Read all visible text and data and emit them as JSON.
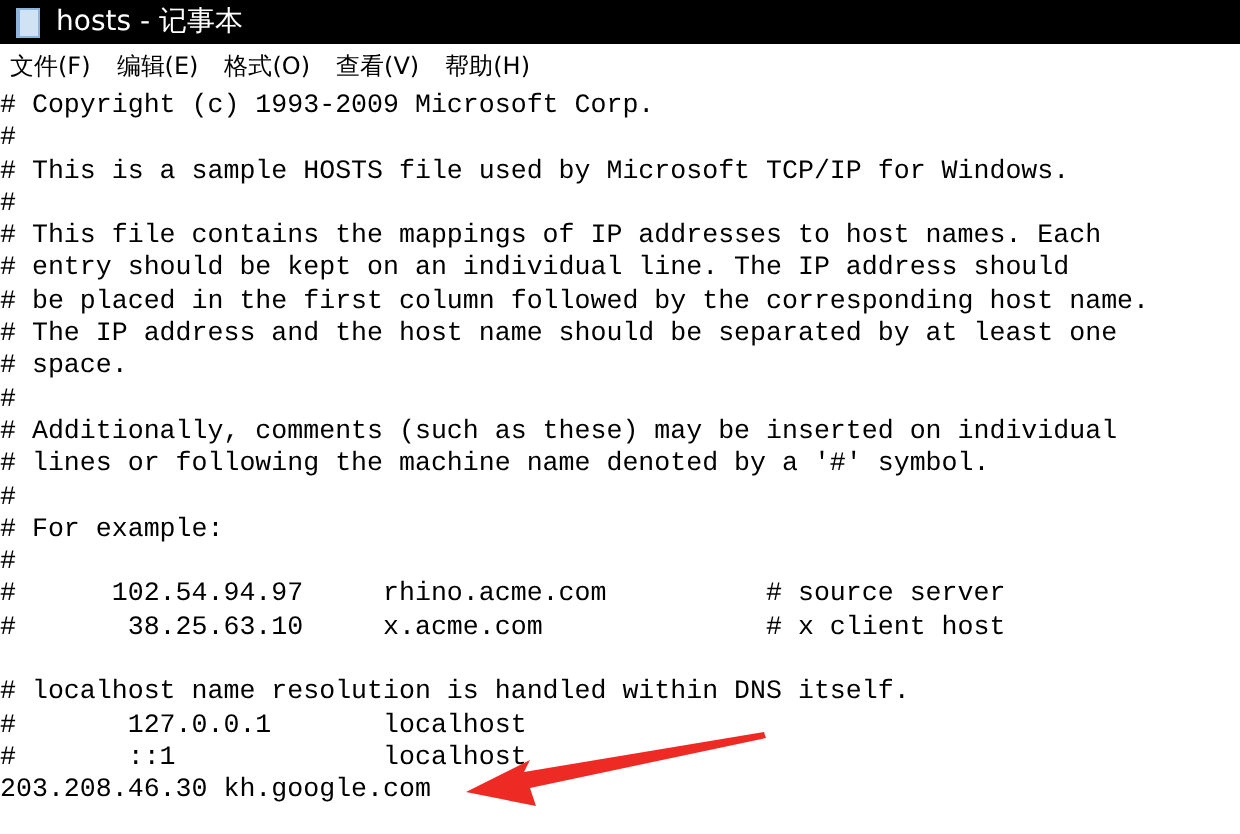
{
  "window": {
    "title": "hosts - 记事本"
  },
  "menu": [
    "文件(F)",
    "编辑(E)",
    "格式(O)",
    "查看(V)",
    "帮助(H)"
  ],
  "text_blocks": [
    [
      "# Copyright (c) 1993-2009 Microsoft Corp.",
      "#",
      "# This is a sample HOSTS file used by Microsoft TCP/IP for Windows.",
      "#",
      "# This file contains the mappings of IP addresses to host names. Each",
      "# entry should be kept on an individual line. The IP address should",
      "# be placed in the first column followed by the corresponding host name.",
      "# The IP address and the host name should be separated by at least one",
      "# space.",
      "#",
      "# Additionally, comments (such as these) may be inserted on individual",
      "# lines or following the machine name denoted by a '#' symbol.",
      "#",
      "# For example:",
      "#",
      "#      102.54.94.97     rhino.acme.com          # source server",
      "#       38.25.63.10     x.acme.com              # x client host"
    ],
    [
      "# localhost name resolution is handled within DNS itself.",
      "#       127.0.0.1       localhost",
      "#       ::1             localhost",
      "203.208.46.30 kh.google.com"
    ]
  ],
  "annotation": {
    "kind": "arrow"
  }
}
